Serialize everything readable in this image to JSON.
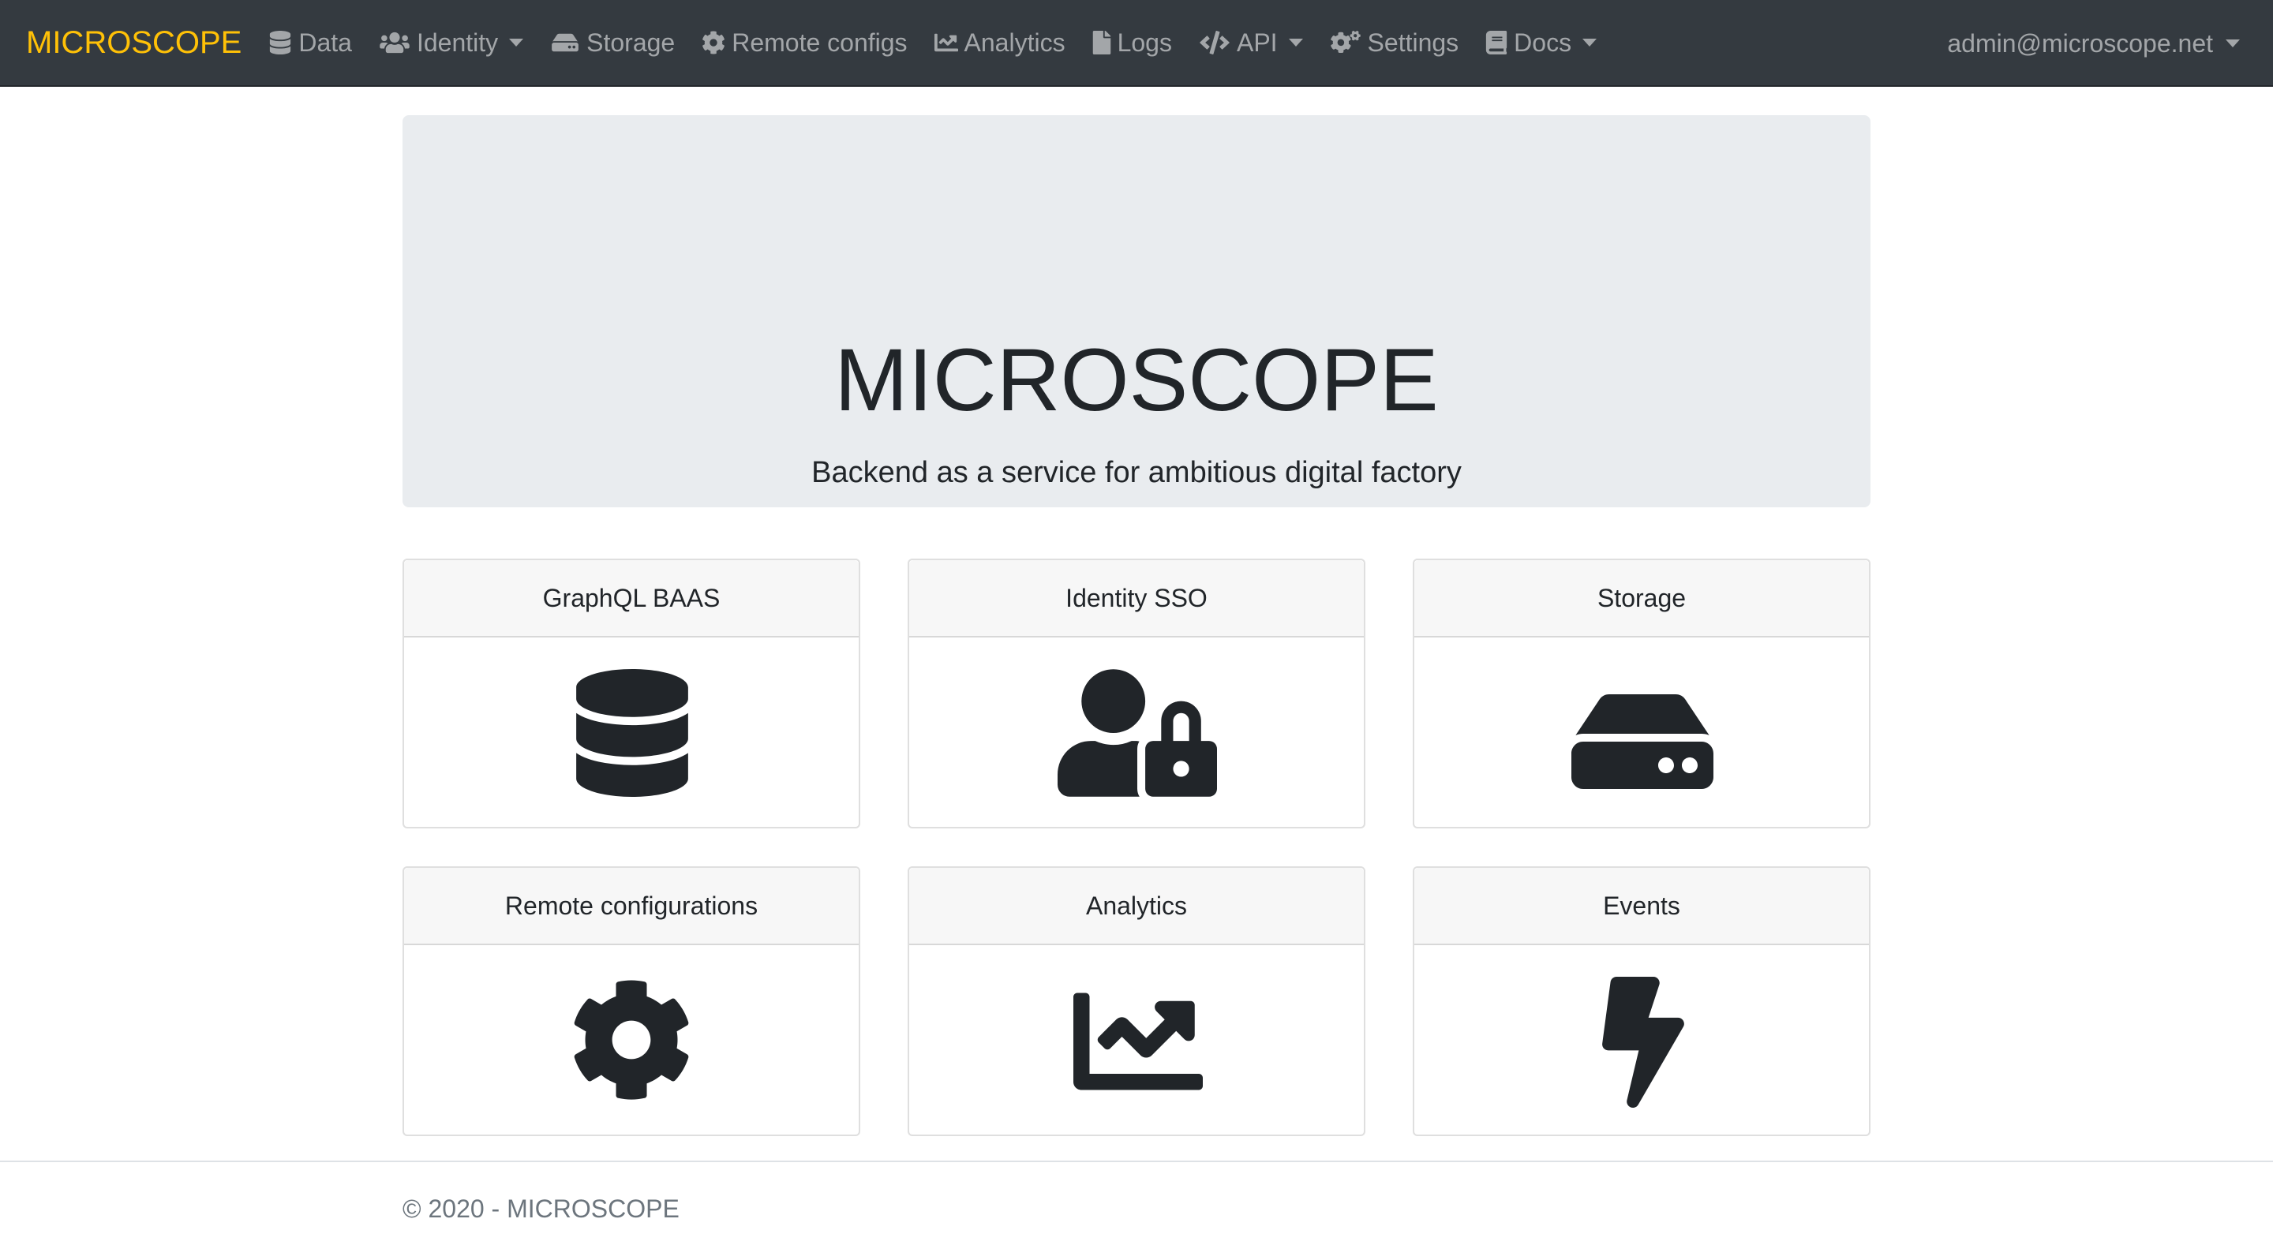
{
  "navbar": {
    "brand": "MICROSCOPE",
    "brand_color": "#ffc107",
    "items": [
      {
        "label": "Data",
        "icon": "database-icon",
        "dropdown": false
      },
      {
        "label": "Identity",
        "icon": "users-icon",
        "dropdown": true
      },
      {
        "label": "Storage",
        "icon": "hdd-icon",
        "dropdown": false
      },
      {
        "label": "Remote configs",
        "icon": "cog-icon",
        "dropdown": false
      },
      {
        "label": "Analytics",
        "icon": "chart-line-icon",
        "dropdown": false
      },
      {
        "label": "Logs",
        "icon": "file-icon",
        "dropdown": false
      },
      {
        "label": "API",
        "icon": "code-icon",
        "dropdown": true
      },
      {
        "label": "Settings",
        "icon": "cogs-icon",
        "dropdown": false
      },
      {
        "label": "Docs",
        "icon": "book-icon",
        "dropdown": true
      }
    ],
    "user": "admin@microscope.net"
  },
  "jumbotron": {
    "title": "MICROSCOPE",
    "subtitle": "Backend as a service for ambitious digital factory"
  },
  "cards": [
    {
      "title": "GraphQL BAAS",
      "icon": "database-icon"
    },
    {
      "title": "Identity SSO",
      "icon": "user-lock-icon"
    },
    {
      "title": "Storage",
      "icon": "hdd-icon"
    },
    {
      "title": "Remote configurations",
      "icon": "cog-icon"
    },
    {
      "title": "Analytics",
      "icon": "chart-line-icon"
    },
    {
      "title": "Events",
      "icon": "bolt-icon"
    }
  ],
  "footer": {
    "text": "© 2020 - MICROSCOPE"
  }
}
